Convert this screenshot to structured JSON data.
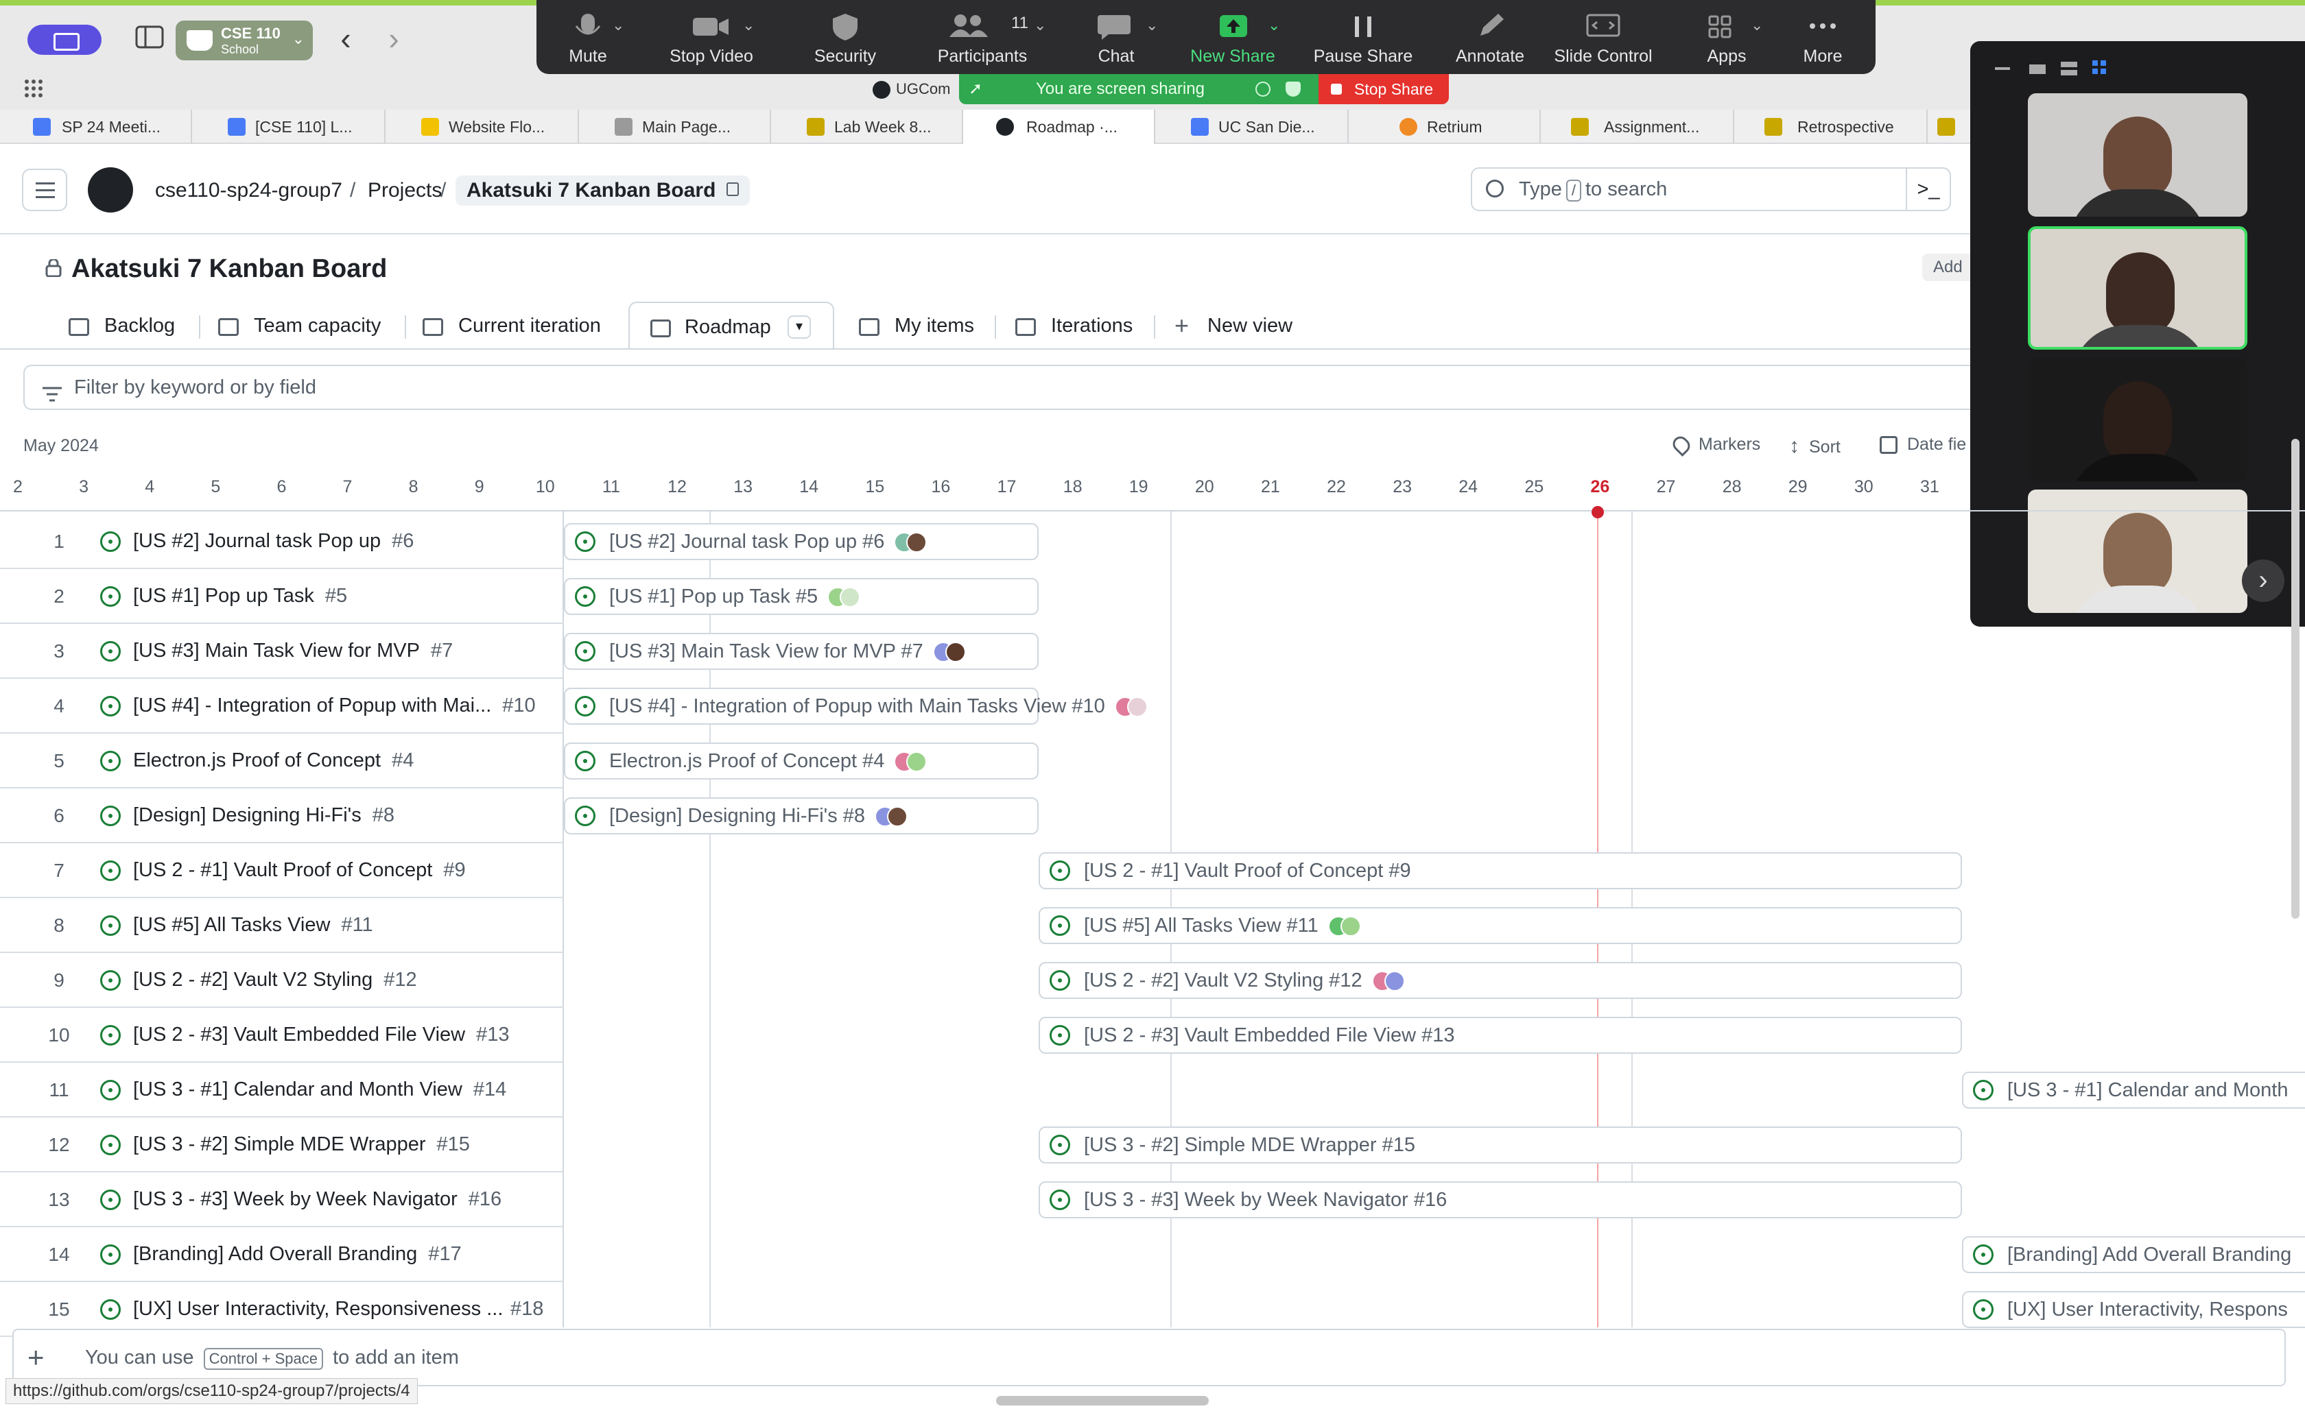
{
  "browser": {
    "space_name": "CSE 110",
    "space_sub": "School",
    "tabs": [
      {
        "label": "SP 24 Meeti...",
        "color": "#4a7bf7"
      },
      {
        "label": "[CSE 110] L...",
        "color": "#4a7bf7"
      },
      {
        "label": "Website Flo...",
        "color": "#f2c200"
      },
      {
        "label": "Main Page...",
        "color": "#9a9a9a"
      },
      {
        "label": "Lab Week 8...",
        "color": "#c8a800"
      },
      {
        "label": "Roadmap ·...",
        "color": "#1f2328"
      },
      {
        "label": "UC San Die...",
        "color": "#4a7bf7"
      },
      {
        "label": "Retrium",
        "color": "#f08a24"
      },
      {
        "label": "Assignment...",
        "color": "#c8a800"
      },
      {
        "label": "Retrospective",
        "color": "#c8a800"
      }
    ],
    "status_url": "https://github.com/orgs/cse110-sp24-group7/projects/4"
  },
  "zoom": {
    "buttons": {
      "mute": "Mute",
      "stop_video": "Stop Video",
      "security": "Security",
      "participants": "Participants",
      "participants_count": "11",
      "chat": "Chat",
      "new_share": "New Share",
      "pause_share": "Pause Share",
      "annotate": "Annotate",
      "slide_control": "Slide Control",
      "apps": "Apps",
      "more": "More"
    },
    "sharing_text": "You are screen sharing",
    "stop_share": "Stop Share",
    "ugcom": "UGCom"
  },
  "github": {
    "org": "cse110-sp24-group7",
    "projects": "Projects",
    "project_name": "Akatsuki 7 Kanban Board",
    "search_pre": "Type",
    "search_key": "/",
    "search_post": "to search",
    "add_label": "Add",
    "title": "Akatsuki 7 Kanban Board"
  },
  "view_tabs": [
    "Backlog",
    "Team capacity",
    "Current iteration",
    "Roadmap",
    "My items",
    "Iterations",
    "New view"
  ],
  "filter_placeholder": "Filter by keyword or by field",
  "roadmap": {
    "month": "May 2024",
    "markers": "Markers",
    "sort": "Sort",
    "date_fields": "Date fie",
    "days": [
      "2",
      "3",
      "4",
      "5",
      "6",
      "7",
      "8",
      "9",
      "10",
      "11",
      "12",
      "13",
      "14",
      "15",
      "16",
      "17",
      "18",
      "19",
      "20",
      "21",
      "22",
      "23",
      "24",
      "25",
      "26",
      "27",
      "28",
      "29",
      "30",
      "31"
    ],
    "today": "26"
  },
  "items": [
    {
      "n": "1",
      "title": "[US #2] Journal task Pop up",
      "num": "#6",
      "bar": "[US #2] Journal task Pop up #6"
    },
    {
      "n": "2",
      "title": "[US #1] Pop up Task",
      "num": "#5",
      "bar": "[US #1] Pop up Task #5"
    },
    {
      "n": "3",
      "title": "[US #3] Main Task View for MVP",
      "num": "#7",
      "bar": "[US #3] Main Task View for MVP #7"
    },
    {
      "n": "4",
      "title": "[US #4] - Integration of Popup with Mai...",
      "num": "#10",
      "bar": "[US #4] - Integration of Popup with Main Tasks View #10"
    },
    {
      "n": "5",
      "title": "Electron.js Proof of Concept",
      "num": "#4",
      "bar": "Electron.js Proof of Concept #4"
    },
    {
      "n": "6",
      "title": "[Design] Designing Hi-Fi's",
      "num": "#8",
      "bar": "[Design] Designing Hi-Fi's #8"
    },
    {
      "n": "7",
      "title": "[US 2 - #1] Vault Proof of Concept",
      "num": "#9",
      "bar": "[US 2 - #1] Vault Proof of Concept #9"
    },
    {
      "n": "8",
      "title": "[US #5] All Tasks View",
      "num": "#11",
      "bar": "[US #5] All Tasks View #11"
    },
    {
      "n": "9",
      "title": "[US 2 - #2] Vault V2 Styling",
      "num": "#12",
      "bar": "[US 2 - #2] Vault V2 Styling #12"
    },
    {
      "n": "10",
      "title": "[US 2 - #3] Vault Embedded File View",
      "num": "#13",
      "bar": "[US 2 - #3] Vault Embedded File View #13"
    },
    {
      "n": "11",
      "title": "[US 3 - #1] Calendar and Month View",
      "num": "#14",
      "bar": "[US 3 - #1] Calendar and Month"
    },
    {
      "n": "12",
      "title": "[US 3 - #2] Simple MDE Wrapper",
      "num": "#15",
      "bar": "[US 3 - #2] Simple MDE Wrapper #15"
    },
    {
      "n": "13",
      "title": "[US 3 - #3] Week by Week Navigator",
      "num": "#16",
      "bar": "[US 3 - #3] Week by Week Navigator #16"
    },
    {
      "n": "14",
      "title": "[Branding] Add Overall Branding",
      "num": "#17",
      "bar": "[Branding] Add Overall Branding"
    },
    {
      "n": "15",
      "title": "[UX] User Interactivity, Responsiveness ...",
      "num": "#18",
      "bar": "[UX] User Interactivity, Respons"
    }
  ],
  "add_item": {
    "pre": "You can use",
    "key": "Control + Space",
    "post": "to add an item"
  },
  "colors": {
    "accent_green": "#1a7f37",
    "today_red": "#cf222e",
    "zoom_bg": "#2c2c2e"
  }
}
